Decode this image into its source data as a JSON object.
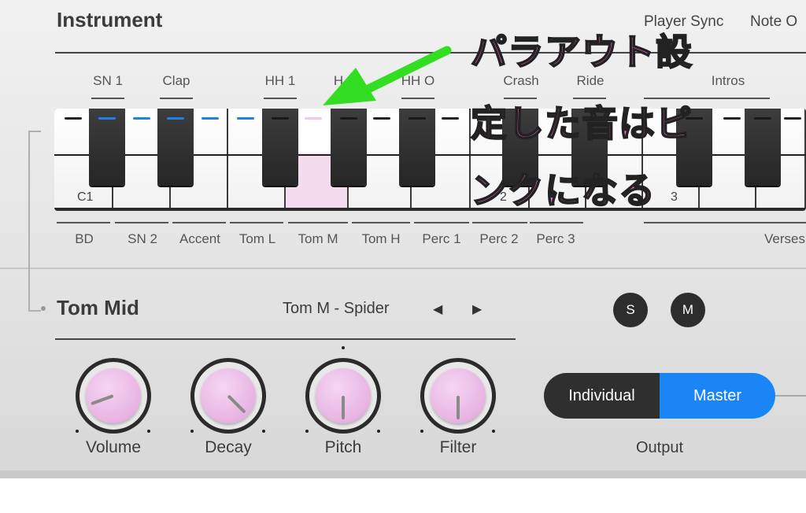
{
  "header": {
    "title": "Instrument",
    "player_sync": "Player Sync",
    "note_o": "Note O"
  },
  "top_labels": [
    "SN 1",
    "Clap",
    "HH 1",
    "H",
    "HH O",
    "Crash",
    "Ride",
    "Intros"
  ],
  "bottom_labels": [
    "BD",
    "SN 2",
    "Accent",
    "Tom L",
    "Tom M",
    "Tom H",
    "Perc 1",
    "Perc 2",
    "Perc 3",
    "Verses"
  ],
  "keyboard": {
    "c1_label": "C1",
    "octave2_label": "2",
    "octave3_label": "3",
    "colors": {
      "blue": "#1f7fe6",
      "pink": "#f5c4ec",
      "dark": "#222222",
      "selected": "#f3dcee"
    }
  },
  "instrument": {
    "name": "Tom Mid",
    "preset": "Tom M - Spider",
    "solo": "S",
    "mute": "M"
  },
  "knobs": [
    {
      "label": "Volume",
      "angle": 250
    },
    {
      "label": "Decay",
      "angle": 135
    },
    {
      "label": "Pitch",
      "angle": 180
    },
    {
      "label": "Filter",
      "angle": 180
    }
  ],
  "output": {
    "individual": "Individual",
    "master": "Master",
    "selected": "Master",
    "label": "Output",
    "accent": "#1a86f5"
  },
  "annotation": {
    "line1": "パラアウト設",
    "line2": "定した音はピ",
    "line3": "ンクになる",
    "text_color": "#ff66d8",
    "arrow_color": "#33dd22"
  }
}
